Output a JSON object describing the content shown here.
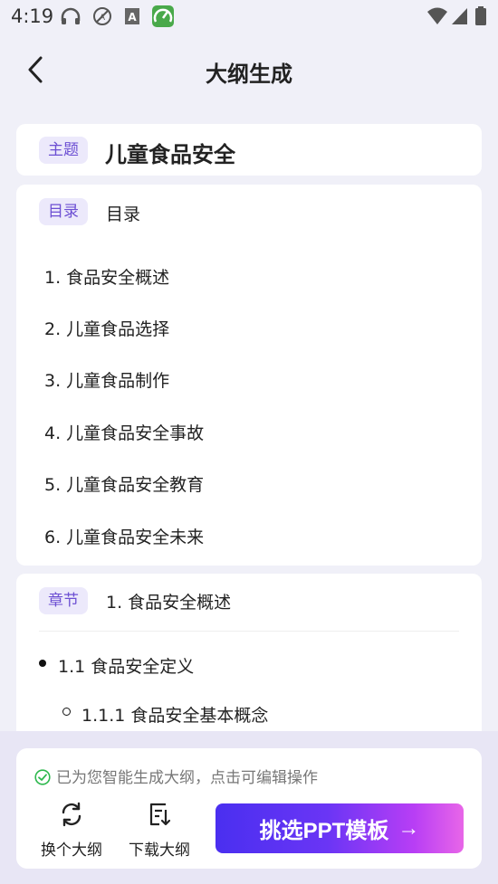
{
  "status_bar": {
    "time": "4:19"
  },
  "header": {
    "title": "大纲生成"
  },
  "topic": {
    "tag": "主题",
    "value": "儿童食品安全"
  },
  "toc": {
    "tag": "目录",
    "heading": "目录",
    "items": [
      "1. 食品安全概述",
      "2. 儿童食品选择",
      "3. 儿童食品制作",
      "4. 儿童食品安全事故",
      "5. 儿童食品安全教育",
      "6. 儿童食品安全未来"
    ]
  },
  "chapter": {
    "tag": "章节",
    "heading": "1. 食品安全概述",
    "level1": "1.1 食品安全定义",
    "level2": "1.1.1 食品安全基本概念"
  },
  "bottom": {
    "hint": "已为您智能生成大纲，点击可编辑操作",
    "switch_label": "换个大纲",
    "download_label": "下载大纲",
    "primary_label": "挑选PPT模板",
    "primary_arrow": "→"
  },
  "colors": {
    "accent": "#6c4fd3",
    "tag_bg": "#ece9fb",
    "hint_check": "#2db84d"
  }
}
